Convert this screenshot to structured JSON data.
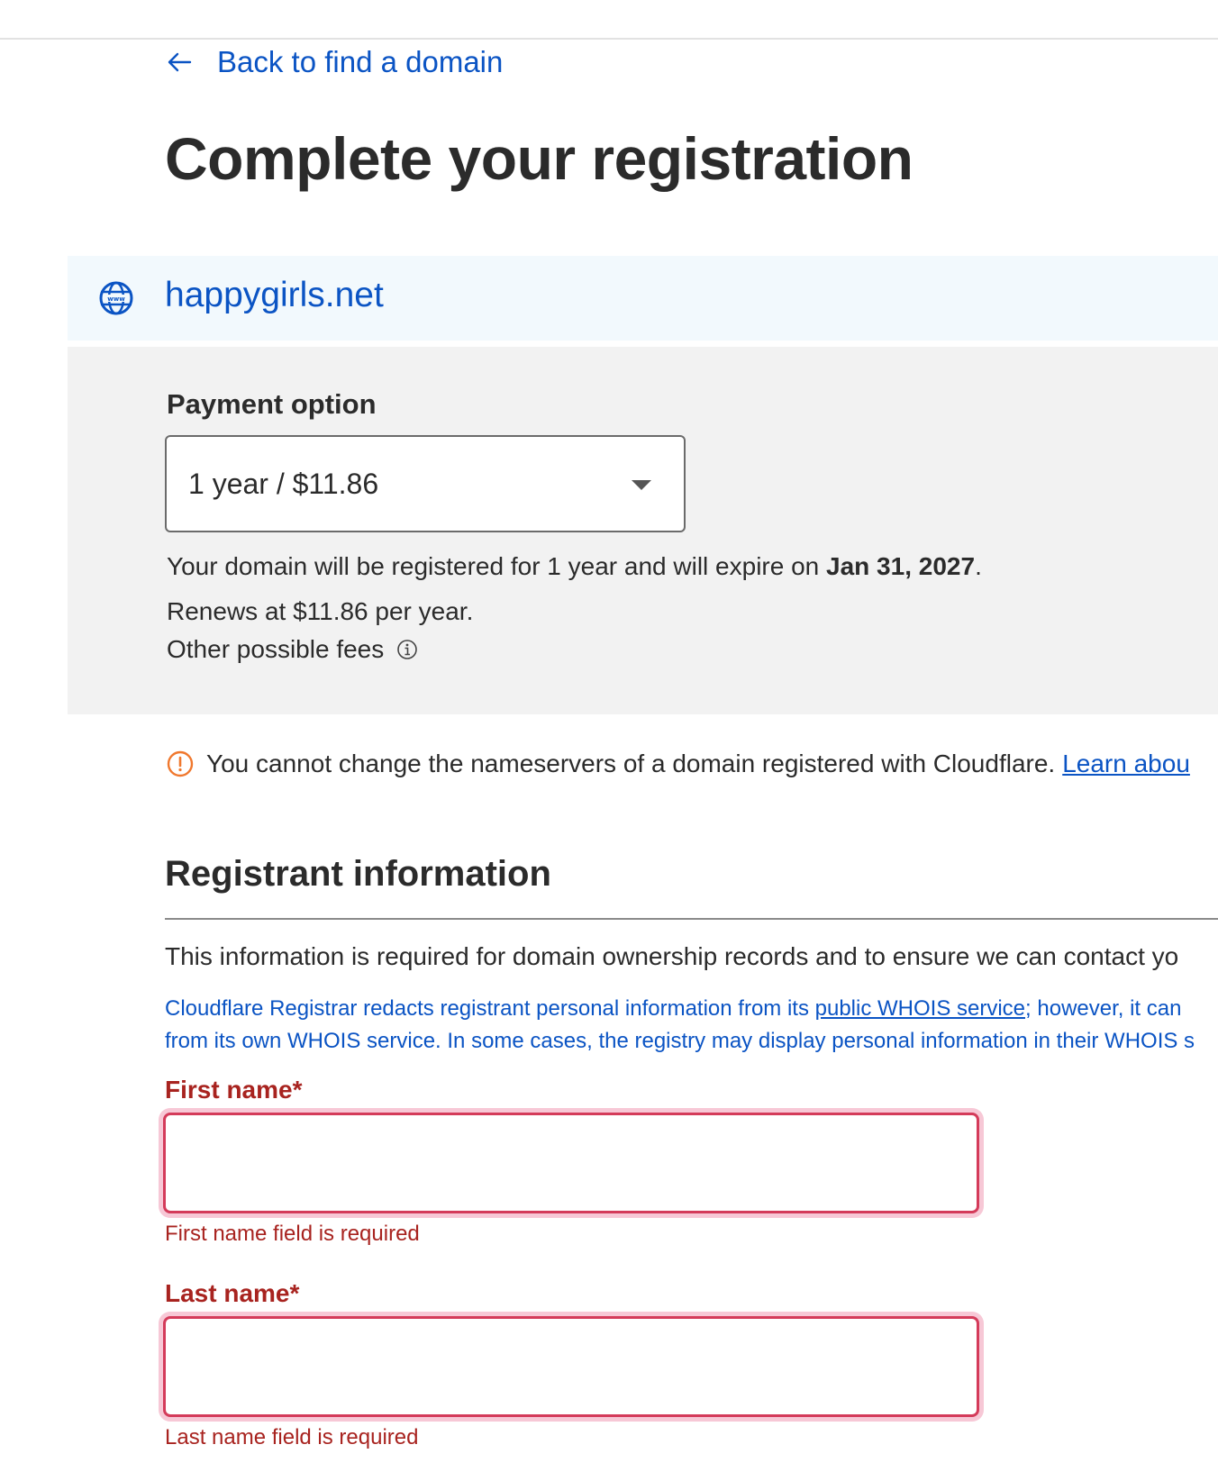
{
  "nav": {
    "back_label": "Back to find a domain"
  },
  "page": {
    "title": "Complete your registration"
  },
  "domain": {
    "name": "happygirls.net"
  },
  "payment": {
    "label": "Payment option",
    "selected": "1 year / $11.86",
    "expire_prefix": "Your domain will be registered for 1 year and will expire on ",
    "expire_date": "Jan 31, 2027",
    "expire_suffix": ".",
    "renews": "Renews at $11.86 per year.",
    "other_fees": "Other possible fees"
  },
  "notice": {
    "text": "You cannot change the nameservers of a domain registered with Cloudflare.",
    "link": "Learn abou"
  },
  "registrant": {
    "title": "Registrant information",
    "description": "This information is required for domain ownership records and to ensure we can contact yo",
    "privacy_line1_prefix": "Cloudflare Registrar redacts registrant personal information from its ",
    "privacy_link": "public WHOIS service",
    "privacy_line1_suffix": "; however, it can",
    "privacy_line2": "from its own WHOIS service. In some cases, the registry may display personal information in their WHOIS s"
  },
  "fields": {
    "first_name": {
      "label": "First name*",
      "value": "",
      "error": "First name field is required"
    },
    "last_name": {
      "label": "Last name*",
      "value": "",
      "error": "Last name field is required"
    }
  },
  "colors": {
    "link": "#0b54c4",
    "error": "#a8231f",
    "error_border": "#d43b5a",
    "warning": "#f0782e",
    "domain_bar_bg": "#f2f9fd",
    "panel_bg": "#f2f2f2"
  },
  "icons": {
    "back": "arrow-left-icon",
    "domain": "globe-www-icon",
    "select": "caret-down-icon",
    "fees": "info-icon",
    "notice": "warning-circle-icon"
  }
}
